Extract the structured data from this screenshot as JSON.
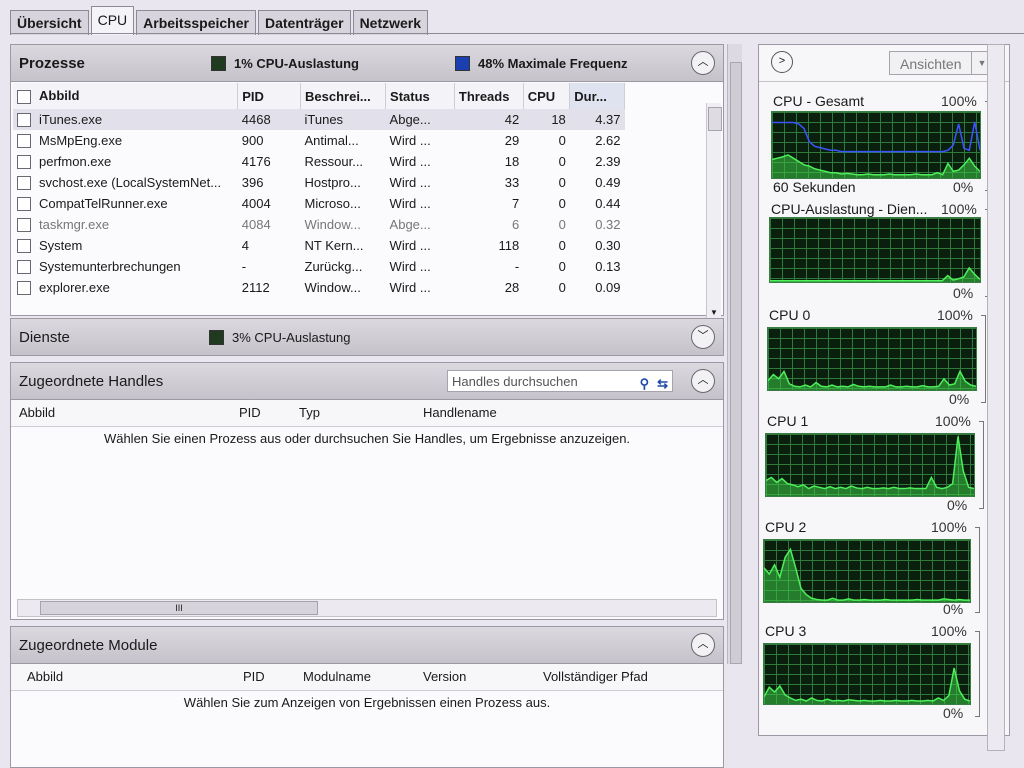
{
  "tabs": [
    "Übersicht",
    "CPU",
    "Arbeitsspeicher",
    "Datenträger",
    "Netzwerk"
  ],
  "active_tab": "CPU",
  "processes": {
    "title": "Prozesse",
    "cpu_usage": "1% CPU-Auslastung",
    "max_freq": "48% Maximale Frequenz",
    "columns": [
      "Abbild",
      "PID",
      "Beschrei...",
      "Status",
      "Threads",
      "CPU",
      "Dur..."
    ],
    "rows": [
      {
        "name": "iTunes.exe",
        "pid": "4468",
        "desc": "iTunes",
        "status": "Abge...",
        "threads": "42",
        "cpu": "18",
        "avg": "4.37",
        "selected": true
      },
      {
        "name": "MsMpEng.exe",
        "pid": "900",
        "desc": "Antimal...",
        "status": "Wird ...",
        "threads": "29",
        "cpu": "0",
        "avg": "2.62"
      },
      {
        "name": "perfmon.exe",
        "pid": "4176",
        "desc": "Ressour...",
        "status": "Wird ...",
        "threads": "18",
        "cpu": "0",
        "avg": "2.39"
      },
      {
        "name": "svchost.exe (LocalSystemNet...",
        "pid": "396",
        "desc": "Hostpro...",
        "status": "Wird ...",
        "threads": "33",
        "cpu": "0",
        "avg": "0.49"
      },
      {
        "name": "CompatTelRunner.exe",
        "pid": "4004",
        "desc": "Microso...",
        "status": "Wird ...",
        "threads": "7",
        "cpu": "0",
        "avg": "0.44"
      },
      {
        "name": "taskmgr.exe",
        "pid": "4084",
        "desc": "Window...",
        "status": "Abge...",
        "threads": "6",
        "cpu": "0",
        "avg": "0.32",
        "gray": true
      },
      {
        "name": "System",
        "pid": "4",
        "desc": "NT Kern...",
        "status": "Wird ...",
        "threads": "118",
        "cpu": "0",
        "avg": "0.30"
      },
      {
        "name": "Systemunterbrechungen",
        "pid": "-",
        "desc": "Zurückg...",
        "status": "Wird ...",
        "threads": "-",
        "cpu": "0",
        "avg": "0.13"
      },
      {
        "name": "explorer.exe",
        "pid": "2112",
        "desc": "Window...",
        "status": "Wird ...",
        "threads": "28",
        "cpu": "0",
        "avg": "0.09"
      }
    ]
  },
  "services": {
    "title": "Dienste",
    "cpu_usage": "3% CPU-Auslastung"
  },
  "handles": {
    "title": "Zugeordnete Handles",
    "search_placeholder": "Handles durchsuchen",
    "columns": [
      "Abbild",
      "PID",
      "Typ",
      "Handlename"
    ],
    "hint": "Wählen Sie einen Prozess aus oder durchsuchen Sie Handles, um Ergebnisse anzuzeigen.",
    "scroll_thumb": "III"
  },
  "modules": {
    "title": "Zugeordnete Module",
    "columns": [
      "Abbild",
      "PID",
      "Modulname",
      "Version",
      "Vollständiger Pfad"
    ],
    "hint": "Wählen Sie zum Anzeigen von Ergebnissen einen Prozess aus."
  },
  "right_panel": {
    "views_label": "Ansichten",
    "graphs": [
      {
        "label": "CPU - Gesamt",
        "max": "100%",
        "min": "0%",
        "bottom_label": "60 Sekunden",
        "green": [
          0.28,
          0.3,
          0.32,
          0.35,
          0.3,
          0.25,
          0.2,
          0.18,
          0.14,
          0.12,
          0.1,
          0.08,
          0.08,
          0.06,
          0.07,
          0.06,
          0.05,
          0.05,
          0.06,
          0.05,
          0.05,
          0.05,
          0.06,
          0.05,
          0.05,
          0.05,
          0.05,
          0.06,
          0.05,
          0.05,
          0.05,
          0.08,
          0.05,
          0.22,
          0.1,
          0.12,
          0.2,
          0.3,
          0.18,
          0.1
        ],
        "blue": [
          0.84,
          0.84,
          0.84,
          0.84,
          0.84,
          0.82,
          0.75,
          0.55,
          0.48,
          0.46,
          0.44,
          0.42,
          0.42,
          0.4,
          0.4,
          0.4,
          0.4,
          0.4,
          0.4,
          0.4,
          0.4,
          0.4,
          0.4,
          0.4,
          0.4,
          0.4,
          0.4,
          0.4,
          0.4,
          0.4,
          0.4,
          0.4,
          0.4,
          0.42,
          0.5,
          0.82,
          0.45,
          0.42,
          0.85,
          0.42
        ]
      },
      {
        "label": "CPU-Auslastung - Dien...",
        "max": "100%",
        "min": "0%",
        "green": [
          0.02,
          0.02,
          0.02,
          0.02,
          0.02,
          0.02,
          0.02,
          0.02,
          0.02,
          0.02,
          0.02,
          0.02,
          0.02,
          0.02,
          0.02,
          0.02,
          0.02,
          0.02,
          0.02,
          0.02,
          0.02,
          0.02,
          0.02,
          0.02,
          0.02,
          0.02,
          0.02,
          0.02,
          0.02,
          0.02,
          0.02,
          0.02,
          0.02,
          0.1,
          0.03,
          0.05,
          0.08,
          0.22,
          0.12,
          0.04
        ]
      },
      {
        "label": "CPU 0",
        "max": "100%",
        "min": "0%",
        "green": [
          0.15,
          0.25,
          0.18,
          0.3,
          0.1,
          0.06,
          0.05,
          0.08,
          0.05,
          0.12,
          0.06,
          0.05,
          0.08,
          0.05,
          0.06,
          0.05,
          0.09,
          0.06,
          0.05,
          0.06,
          0.05,
          0.05,
          0.05,
          0.08,
          0.05,
          0.05,
          0.06,
          0.05,
          0.05,
          0.07,
          0.05,
          0.05,
          0.06,
          0.18,
          0.08,
          0.1,
          0.3,
          0.14,
          0.08,
          0.06
        ]
      },
      {
        "label": "CPU 1",
        "max": "100%",
        "min": "0%",
        "green": [
          0.25,
          0.3,
          0.22,
          0.28,
          0.2,
          0.18,
          0.15,
          0.18,
          0.12,
          0.16,
          0.14,
          0.12,
          0.15,
          0.12,
          0.14,
          0.12,
          0.16,
          0.13,
          0.12,
          0.14,
          0.12,
          0.12,
          0.13,
          0.12,
          0.14,
          0.12,
          0.12,
          0.13,
          0.12,
          0.12,
          0.12,
          0.3,
          0.14,
          0.12,
          0.14,
          0.2,
          0.96,
          0.4,
          0.14,
          0.12
        ]
      },
      {
        "label": "CPU 2",
        "max": "100%",
        "min": "0%",
        "green": [
          0.55,
          0.45,
          0.6,
          0.4,
          0.72,
          0.85,
          0.55,
          0.22,
          0.12,
          0.06,
          0.04,
          0.03,
          0.03,
          0.06,
          0.03,
          0.03,
          0.05,
          0.03,
          0.03,
          0.04,
          0.03,
          0.03,
          0.03,
          0.04,
          0.03,
          0.03,
          0.03,
          0.03,
          0.03,
          0.04,
          0.03,
          0.03,
          0.03,
          0.03,
          0.05,
          0.04,
          0.03,
          0.04,
          0.03,
          0.03
        ]
      },
      {
        "label": "CPU 3",
        "max": "100%",
        "min": "0%",
        "green": [
          0.12,
          0.28,
          0.2,
          0.3,
          0.15,
          0.1,
          0.06,
          0.08,
          0.05,
          0.1,
          0.06,
          0.05,
          0.08,
          0.05,
          0.06,
          0.05,
          0.07,
          0.06,
          0.05,
          0.06,
          0.05,
          0.05,
          0.06,
          0.05,
          0.05,
          0.06,
          0.05,
          0.05,
          0.06,
          0.05,
          0.05,
          0.06,
          0.05,
          0.1,
          0.06,
          0.14,
          0.6,
          0.22,
          0.08,
          0.05
        ]
      }
    ]
  }
}
